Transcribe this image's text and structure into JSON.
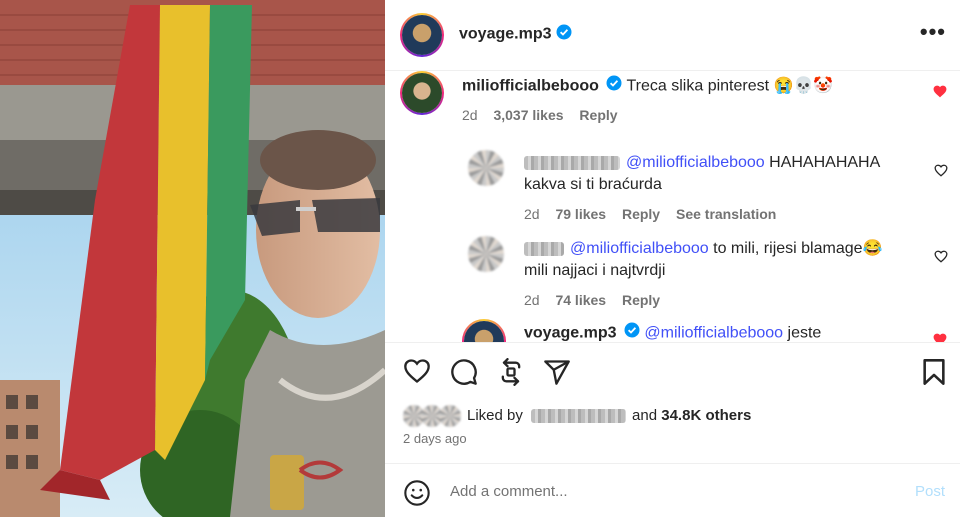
{
  "post": {
    "author": "voyage.mp3",
    "more_label": "•••"
  },
  "comments": [
    {
      "user": "miliofficialbebooo",
      "text": "Treca slika pinterest 😭💀🤡",
      "time": "2d",
      "likes": "3,037 likes",
      "reply": "Reply"
    },
    {
      "user": "",
      "mention": "@miliofficialbebooo",
      "text1": " HAHAHAHAHA",
      "text2": "kakva si ti braćurda",
      "time": "2d",
      "likes": "79 likes",
      "reply": "Reply",
      "translate": "See translation"
    },
    {
      "user": "",
      "mention": "@miliofficialbebooo",
      "text1": " to mili, rijesi blamage😂",
      "text2": "mili najjaci i najtvrdji",
      "time": "2d",
      "likes": "74 likes",
      "reply": "Reply"
    },
    {
      "user": "voyage.mp3",
      "mention": "@miliofficialbebooo",
      "text1": " jeste"
    }
  ],
  "likes": {
    "liked_by": "Liked by",
    "and": "and",
    "others": "34.8K others",
    "date": "2 days ago"
  },
  "add_comment": {
    "placeholder": "Add a comment...",
    "post_label": "Post"
  },
  "icons": {
    "like": "heart-icon",
    "comment": "comment-icon",
    "repost": "repost-icon",
    "share": "share-icon",
    "save": "bookmark-icon",
    "emoji": "emoji-icon",
    "verified": "verified-badge-icon"
  },
  "colors": {
    "accent": "#0095f6",
    "like_red": "#ff3040",
    "mention_blue": "#4150f7",
    "muted": "#737373"
  }
}
